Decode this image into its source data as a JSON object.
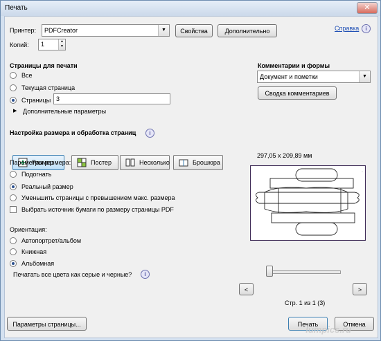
{
  "window": {
    "title": "Печать",
    "close_glyph": "✕"
  },
  "printer": {
    "label": "Принтер:",
    "value": "PDFCreator",
    "properties_button": "Свойства",
    "advanced_button": "Дополнительно",
    "help_link": "Справка",
    "help_icon": "help-icon"
  },
  "copies": {
    "label": "Копий:",
    "value": "1"
  },
  "pages_to_print": {
    "heading": "Страницы для печати",
    "options": [
      "Все",
      "Текущая страница",
      "Страницы"
    ],
    "selected": 2,
    "pages_value": "3",
    "more_options": "Дополнительные параметры"
  },
  "comments": {
    "heading": "Комментарии и формы",
    "select_value": "Документ и пометки",
    "summary_button": "Сводка комментариев"
  },
  "sizing": {
    "heading": "Настройка размера и обработка страниц",
    "tabs": [
      "Размер",
      "Постер",
      "Несколько",
      "Брошюра"
    ],
    "active_tab": 0,
    "options_label": "Параметры размера:",
    "options": [
      "Подогнать",
      "Реальный размер",
      "Уменьшить страницы с превышением макс. размера"
    ],
    "selected": 1,
    "paper_source_checkbox": "Выбрать источник бумаги по размеру страницы PDF"
  },
  "orientation": {
    "label": "Ориентация:",
    "options": [
      "Автопортрет/альбом",
      "Книжная",
      "Альбомная"
    ],
    "selected": 2
  },
  "grayscale_question": "Печатать все цвета как серые и черные?",
  "preview": {
    "dimensions": "297,05 x 209,89 мм",
    "prev": "<",
    "next": ">",
    "page_status": "Стр. 1 из 1 (3)",
    "slider_fraction": 0
  },
  "footer": {
    "page_setup_button": "Параметры страницы...",
    "print_button": "Печать",
    "cancel_button": "Отмена",
    "watermark": "lumpics.ru"
  },
  "colors": {
    "accent": "#3c7fb1",
    "frame": "#3e2b56",
    "link": "#1f4fb5"
  }
}
